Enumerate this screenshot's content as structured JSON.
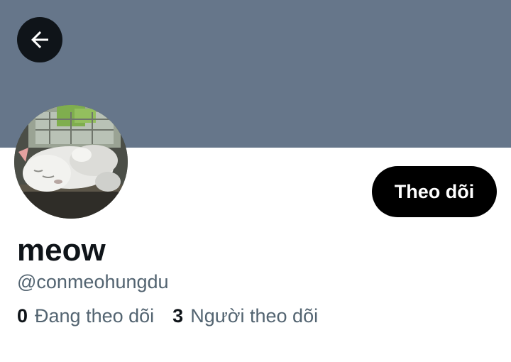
{
  "header": {
    "back_icon": "arrow-left-icon",
    "banner_color": "#66768a"
  },
  "profile": {
    "display_name": "meow",
    "handle": "@conmeohungdu",
    "follow_label": "Theo dõi",
    "avatar": "sleeping-cat-photo"
  },
  "stats": {
    "following_count": "0",
    "following_label": "Đang theo dõi",
    "followers_count": "3",
    "followers_label": "Người theo dõi"
  },
  "colors": {
    "primary_text": "#0f1419",
    "secondary_text": "#536471",
    "button_bg": "#000000"
  }
}
